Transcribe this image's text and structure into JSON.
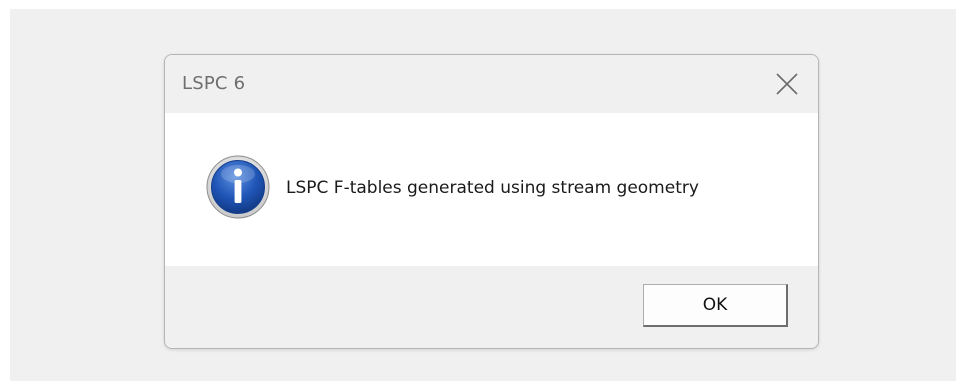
{
  "dialog": {
    "title": "LSPC 6",
    "close_icon": "close-icon",
    "message_icon": "info-icon",
    "message": "LSPC F-tables generated using stream geometry",
    "ok_label": "OK"
  },
  "colors": {
    "info_icon_blue": "#1f54b6",
    "chrome_gray": "#f0f0f0"
  }
}
